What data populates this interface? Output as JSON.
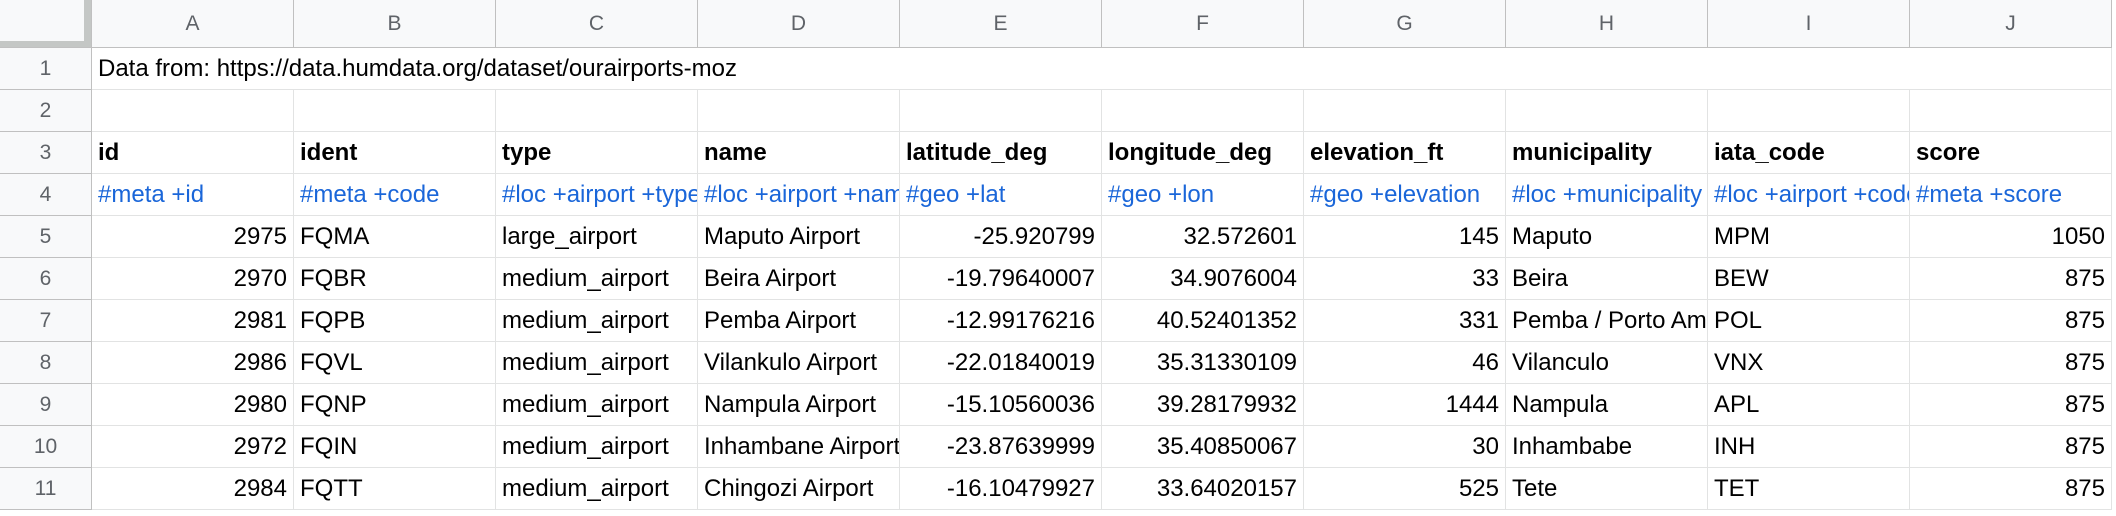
{
  "columns": [
    "A",
    "B",
    "C",
    "D",
    "E",
    "F",
    "G",
    "H",
    "I",
    "J"
  ],
  "row_numbers": [
    "1",
    "2",
    "3",
    "4",
    "5",
    "6",
    "7",
    "8",
    "9",
    "10",
    "11"
  ],
  "note": "Data from: https://data.humdata.org/dataset/ourairports-moz",
  "headers": [
    "id",
    "ident",
    "type",
    "name",
    "latitude_deg",
    "longitude_deg",
    "elevation_ft",
    "municipality",
    "iata_code",
    "score"
  ],
  "hxl_tags": [
    "#meta +id",
    "#meta +code",
    "#loc +airport +type",
    "#loc +airport +name",
    "#geo +lat",
    "#geo +lon",
    "#geo +elevation",
    "#loc +municipality",
    "#loc +airport +code",
    "#meta +score"
  ],
  "rows": [
    [
      "2975",
      "FQMA",
      "large_airport",
      "Maputo Airport",
      "-25.920799",
      "32.572601",
      "145",
      "Maputo",
      "MPM",
      "1050"
    ],
    [
      "2970",
      "FQBR",
      "medium_airport",
      "Beira Airport",
      "-19.79640007",
      "34.9076004",
      "33",
      "Beira",
      "BEW",
      "875"
    ],
    [
      "2981",
      "FQPB",
      "medium_airport",
      "Pemba Airport",
      "-12.99176216",
      "40.52401352",
      "331",
      "Pemba / Porto Amelia",
      "POL",
      "875"
    ],
    [
      "2986",
      "FQVL",
      "medium_airport",
      "Vilankulo Airport",
      "-22.01840019",
      "35.31330109",
      "46",
      "Vilanculo",
      "VNX",
      "875"
    ],
    [
      "2980",
      "FQNP",
      "medium_airport",
      "Nampula Airport",
      "-15.10560036",
      "39.28179932",
      "1444",
      "Nampula",
      "APL",
      "875"
    ],
    [
      "2972",
      "FQIN",
      "medium_airport",
      "Inhambane Airport",
      "-23.87639999",
      "35.40850067",
      "30",
      "Inhambabe",
      "INH",
      "875"
    ],
    [
      "2984",
      "FQTT",
      "medium_airport",
      "Chingozi Airport",
      "-16.10479927",
      "33.64020157",
      "525",
      "Tete",
      "TET",
      "875"
    ]
  ]
}
